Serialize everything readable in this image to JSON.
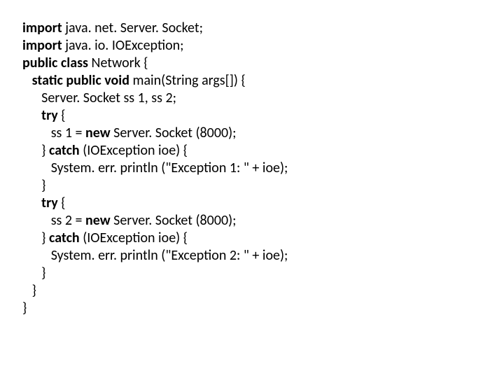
{
  "code": {
    "lines": [
      {
        "indent": 0,
        "segs": [
          {
            "t": "import ",
            "b": true
          },
          {
            "t": "java. net. Server. Socket;",
            "b": false
          }
        ]
      },
      {
        "indent": 0,
        "segs": [
          {
            "t": "import ",
            "b": true
          },
          {
            "t": "java. io. IOException;",
            "b": false
          }
        ]
      },
      {
        "indent": 0,
        "segs": [
          {
            "t": "",
            "b": false
          }
        ]
      },
      {
        "indent": 0,
        "segs": [
          {
            "t": "public class ",
            "b": true
          },
          {
            "t": "Network {",
            "b": false
          }
        ]
      },
      {
        "indent": 1,
        "segs": [
          {
            "t": "static public void ",
            "b": true
          },
          {
            "t": "main(String args[]) {",
            "b": false
          }
        ]
      },
      {
        "indent": 2,
        "segs": [
          {
            "t": "Server. Socket ss 1, ss 2;",
            "b": false
          }
        ]
      },
      {
        "indent": 2,
        "segs": [
          {
            "t": "try ",
            "b": true
          },
          {
            "t": "{",
            "b": false
          }
        ]
      },
      {
        "indent": 3,
        "segs": [
          {
            "t": "ss 1 = ",
            "b": false
          },
          {
            "t": "new ",
            "b": true
          },
          {
            "t": "Server. Socket (8000);",
            "b": false
          }
        ]
      },
      {
        "indent": 2,
        "segs": [
          {
            "t": "} ",
            "b": false
          },
          {
            "t": "catch ",
            "b": true
          },
          {
            "t": "(IOException ioe) {",
            "b": false
          }
        ]
      },
      {
        "indent": 3,
        "segs": [
          {
            "t": "System. err. println (\"Exception 1: \" + ioe);",
            "b": false
          }
        ]
      },
      {
        "indent": 2,
        "segs": [
          {
            "t": "}",
            "b": false
          }
        ]
      },
      {
        "indent": 2,
        "segs": [
          {
            "t": "try ",
            "b": true
          },
          {
            "t": "{",
            "b": false
          }
        ]
      },
      {
        "indent": 3,
        "segs": [
          {
            "t": "ss 2 = ",
            "b": false
          },
          {
            "t": "new ",
            "b": true
          },
          {
            "t": "Server. Socket (8000);",
            "b": false
          }
        ]
      },
      {
        "indent": 2,
        "segs": [
          {
            "t": "} ",
            "b": false
          },
          {
            "t": "catch ",
            "b": true
          },
          {
            "t": "(IOException ioe) {",
            "b": false
          }
        ]
      },
      {
        "indent": 3,
        "segs": [
          {
            "t": "System. err. println (\"Exception 2: \" + ioe);",
            "b": false
          }
        ]
      },
      {
        "indent": 2,
        "segs": [
          {
            "t": "}",
            "b": false
          }
        ]
      },
      {
        "indent": 1,
        "segs": [
          {
            "t": "}",
            "b": false
          }
        ]
      },
      {
        "indent": 0,
        "segs": [
          {
            "t": "}",
            "b": false
          }
        ]
      }
    ]
  }
}
